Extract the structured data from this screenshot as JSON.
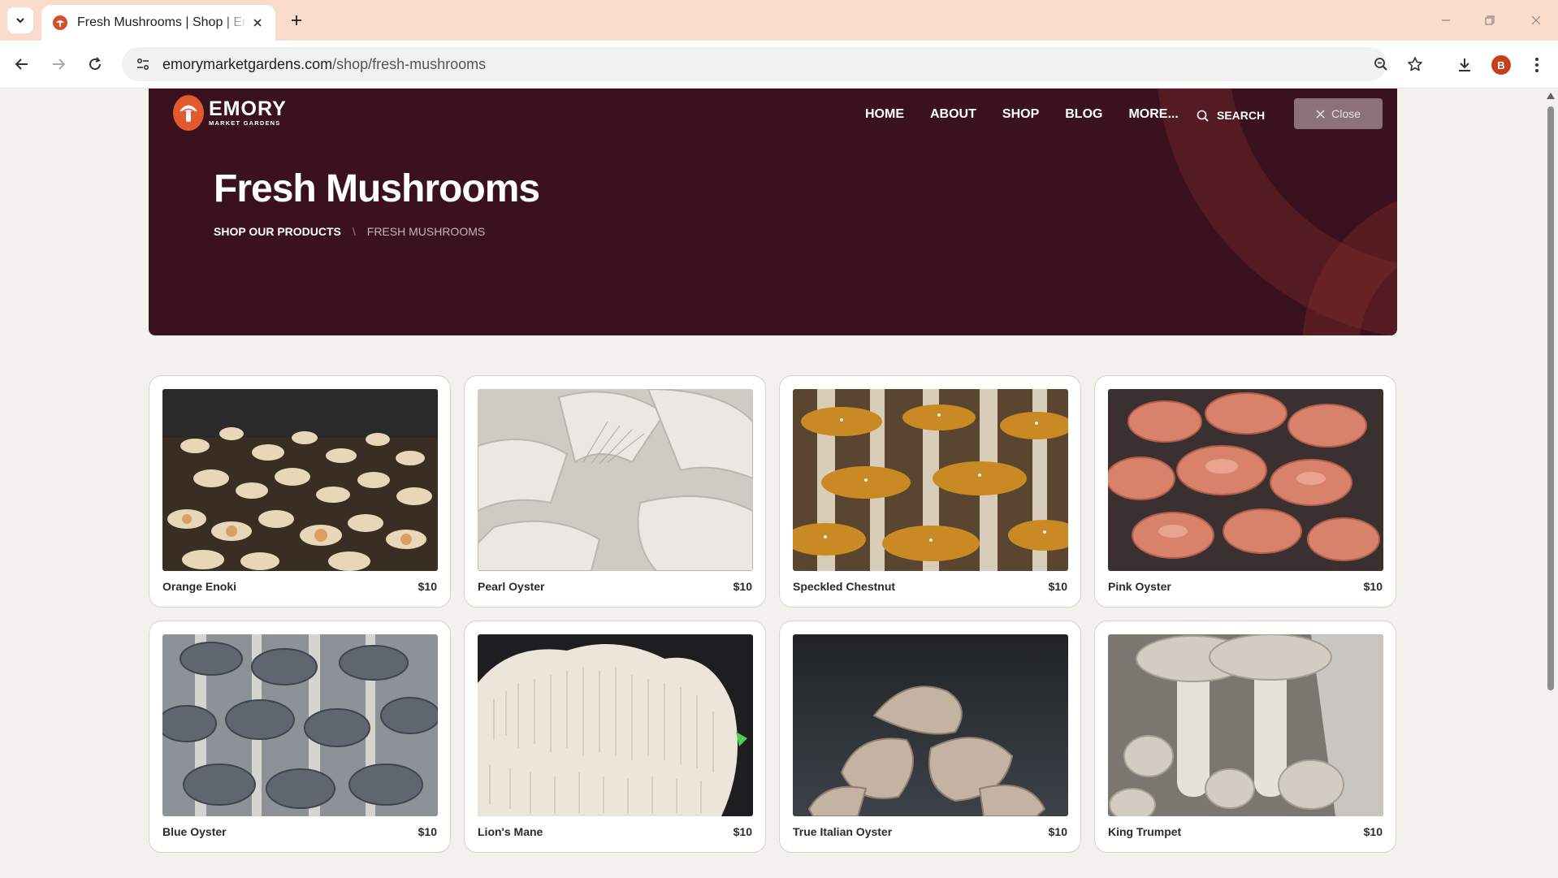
{
  "browser": {
    "tab_title": "Fresh Mushrooms | Shop | Emory Market Gardens",
    "url_domain": "emorymarketgardens.com",
    "url_path": "/shop/fresh-mushrooms",
    "profile_initial": "B"
  },
  "site": {
    "logo_name": "EMORY",
    "logo_sub": "MARKET GARDENS",
    "nav": [
      "HOME",
      "ABOUT",
      "SHOP",
      "BLOG",
      "MORE..."
    ],
    "search_label": "SEARCH",
    "close_label": "Close"
  },
  "hero": {
    "title": "Fresh Mushrooms",
    "breadcrumb_parent": "SHOP OUR PRODUCTS",
    "breadcrumb_sep": "\\",
    "breadcrumb_current": "FRESH MUSHROOMS"
  },
  "products": [
    {
      "name": "Orange Enoki",
      "price": "$10"
    },
    {
      "name": "Pearl Oyster",
      "price": "$10"
    },
    {
      "name": "Speckled Chestnut",
      "price": "$10"
    },
    {
      "name": "Pink Oyster",
      "price": "$10"
    },
    {
      "name": "Blue Oyster",
      "price": "$10"
    },
    {
      "name": "Lion's Mane",
      "price": "$10"
    },
    {
      "name": "True Italian Oyster",
      "price": "$10"
    },
    {
      "name": "King Trumpet",
      "price": "$10"
    }
  ],
  "colors": {
    "hero_bg": "#3a111f",
    "accent": "#e2592e",
    "tabbar": "#f9dccc"
  }
}
